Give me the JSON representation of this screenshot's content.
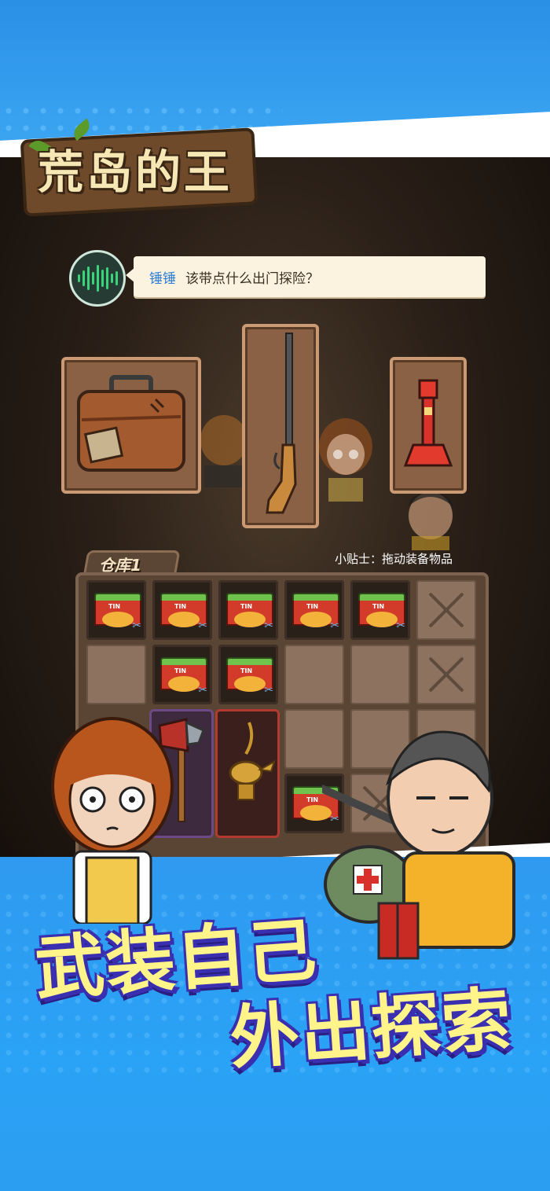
{
  "game": {
    "logo_text": "荒岛的王"
  },
  "dialog": {
    "speaker": "锤锤",
    "message": "该带点什么出门探险？"
  },
  "equipment": [
    {
      "name": "suitcase"
    },
    {
      "name": "rifle"
    },
    {
      "name": "flashlight"
    }
  ],
  "tip": "小贴士：拖动装备物品",
  "warehouse": {
    "tab_label": "仓库1",
    "tin_label": "TIN"
  },
  "slogan": {
    "line1": "武装自己",
    "line2": "外出探索"
  },
  "colors": {
    "sky_blue": "#2f97e8",
    "slogan_fill": "#fff48a",
    "slogan_outline": "#3a2fb0",
    "speaker_blue": "#2f7fd3"
  }
}
